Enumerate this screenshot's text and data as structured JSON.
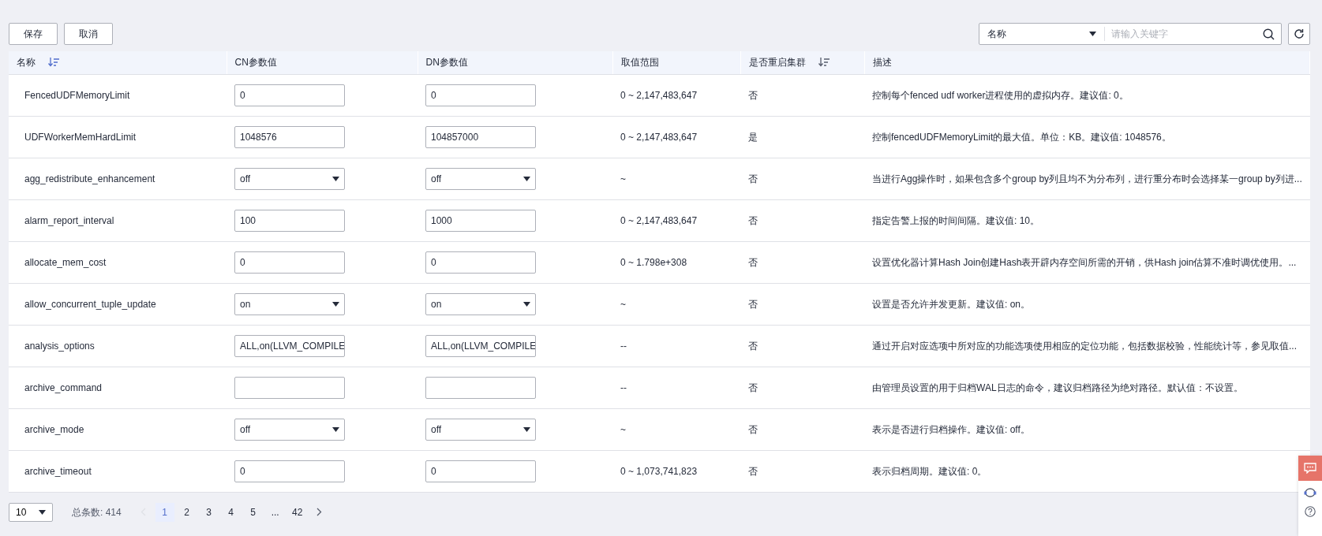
{
  "toolbar": {
    "buttons": [
      "保存",
      "取消"
    ],
    "search_filter": "名称",
    "search": {
      "placeholder": "请输入关键字"
    }
  },
  "table": {
    "columns": [
      {
        "label": "名称",
        "sortable": true
      },
      {
        "label": "CN参数值",
        "sortable": false
      },
      {
        "label": "DN参数值",
        "sortable": false
      },
      {
        "label": "取值范围",
        "sortable": false
      },
      {
        "label": "是否重启集群",
        "sortable": true
      },
      {
        "label": "描述",
        "sortable": false
      }
    ],
    "rows": [
      {
        "name": "FencedUDFMemoryLimit",
        "kind": "text",
        "cn": "0",
        "dn": "0",
        "range": "0 ~ 2,147,483,647",
        "restart": "否",
        "description": "控制每个fenced udf worker进程使用的虚拟内存。建议值: 0。"
      },
      {
        "name": "UDFWorkerMemHardLimit",
        "kind": "text",
        "cn": "1048576",
        "dn": "104857000",
        "range": "0 ~ 2,147,483,647",
        "restart": "是",
        "description": "控制fencedUDFMemoryLimit的最大值。单位：KB。建议值: 1048576。"
      },
      {
        "name": "agg_redistribute_enhancement",
        "kind": "select",
        "cn": "off",
        "dn": "off",
        "range": "~",
        "restart": "否",
        "description": "当进行Agg操作时，如果包含多个group by列且均不为分布列，进行重分布时会选择某一group by列进..."
      },
      {
        "name": "alarm_report_interval",
        "kind": "text",
        "cn": "100",
        "dn": "1000",
        "range": "0 ~ 2,147,483,647",
        "restart": "否",
        "description": "指定告警上报的时间间隔。建议值: 10。"
      },
      {
        "name": "allocate_mem_cost",
        "kind": "text",
        "cn": "0",
        "dn": "0",
        "range": "0 ~ 1.798e+308",
        "restart": "否",
        "description": "设置优化器计算Hash Join创建Hash表开辟内存空间所需的开销，供Hash join估算不准时调优使用。..."
      },
      {
        "name": "allow_concurrent_tuple_update",
        "kind": "select",
        "cn": "on",
        "dn": "on",
        "range": "~",
        "restart": "否",
        "description": "设置是否允许并发更新。建议值: on。"
      },
      {
        "name": "analysis_options",
        "kind": "text",
        "cn": "ALL,on(LLVM_COMPILE",
        "dn": "ALL,on(LLVM_COMPILE",
        "range": "--",
        "restart": "否",
        "description": "通过开启对应选项中所对应的功能选项使用相应的定位功能，包括数据校验，性能统计等，参见取值..."
      },
      {
        "name": "archive_command",
        "kind": "text",
        "cn": "",
        "dn": "",
        "range": "--",
        "restart": "否",
        "description": "由管理员设置的用于归档WAL日志的命令，建议归档路径为绝对路径。默认值：不设置。"
      },
      {
        "name": "archive_mode",
        "kind": "select",
        "cn": "off",
        "dn": "off",
        "range": "~",
        "restart": "否",
        "description": "表示是否进行归档操作。建议值: off。"
      },
      {
        "name": "archive_timeout",
        "kind": "text",
        "cn": "0",
        "dn": "0",
        "range": "0 ~ 1,073,741,823",
        "restart": "否",
        "description": "表示归档周期。建议值: 0。"
      }
    ]
  },
  "pagination": {
    "page_size": "10",
    "total": "总条数: 414",
    "pages": [
      {
        "label": "1",
        "selected": true
      },
      {
        "label": "2",
        "selected": false
      },
      {
        "label": "3",
        "selected": false
      },
      {
        "label": "4",
        "selected": false
      },
      {
        "label": "5",
        "selected": false
      },
      {
        "label": "...",
        "selected": false
      },
      {
        "label": "42",
        "selected": false
      }
    ]
  }
}
